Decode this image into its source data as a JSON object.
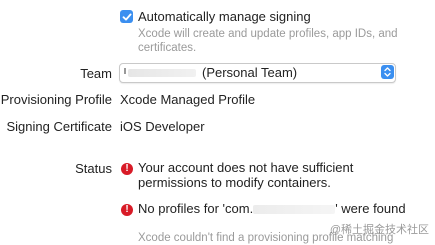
{
  "signing": {
    "auto_manage_checked": true,
    "auto_manage_label": "Automatically manage signing",
    "auto_manage_hint": "Xcode will create and update profiles, app IDs, and certificates."
  },
  "team": {
    "label": "Team",
    "value_suffix": "(Personal Team)"
  },
  "provisioning": {
    "label": "Provisioning Profile",
    "value": "Xcode Managed Profile"
  },
  "certificate": {
    "label": "Signing Certificate",
    "value": "iOS Developer"
  },
  "status": {
    "label": "Status",
    "errors": [
      {
        "text": "Your account does not have sufficient permissions to modify containers."
      },
      {
        "prefix": "No profiles for 'com.",
        "suffix": "' were found"
      }
    ],
    "detail_hint": "Xcode couldn't find a provisioning profile matching"
  },
  "watermark": "@稀土掘金技术社区",
  "colors": {
    "accent": "#3b8ff0",
    "error": "#d81b27",
    "hint_text": "#9a9a9a"
  }
}
